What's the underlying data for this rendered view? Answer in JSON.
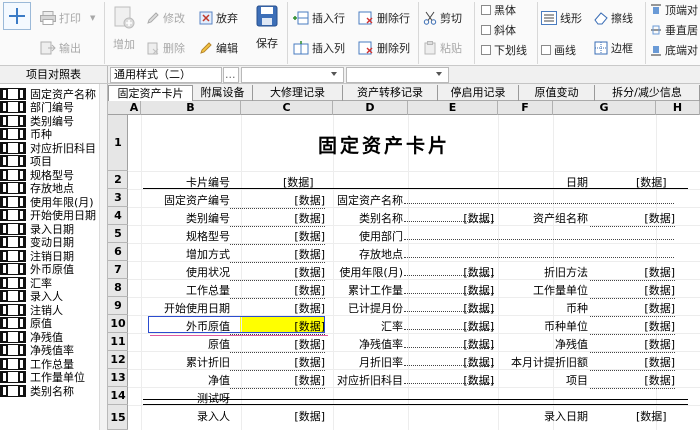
{
  "toolbar": {
    "print": "打印",
    "output": "输出",
    "add": "增加",
    "modify": "修改",
    "delete": "删除",
    "discard": "放弃",
    "edit": "编辑",
    "save": "保存",
    "insert_row": "插入行",
    "insert_col": "插入列",
    "delete_row": "删除行",
    "delete_col": "删除列",
    "cut": "剪切",
    "paste": "粘贴",
    "bold": "黑体",
    "italic": "斜体",
    "underline": "下划线",
    "line_shape": "线形",
    "draw_line": "画线",
    "erase_line": "擦线",
    "border": "边框",
    "align_top": "顶端对",
    "align_middle": "垂直居",
    "align_bottom": "底端对"
  },
  "format_row": {
    "panel_title": "项目对照表",
    "style_value": "通用样式（二）",
    "ellipsis": "..."
  },
  "left_panel": {
    "items": [
      "固定资产名称",
      "部门编号",
      "类别编号",
      "币种",
      "对应折旧科目",
      "项目",
      "规格型号",
      "存放地点",
      "使用年限(月)",
      "开始使用日期",
      "录入日期",
      "变动日期",
      "注销日期",
      "外币原值",
      "汇率",
      "录入人",
      "注销人",
      "原值",
      "净残值",
      "净残值率",
      "工作总量",
      "工作量单位",
      "类别名称"
    ]
  },
  "tabs": [
    "固定资产卡片",
    "附属设备",
    "大修理记录",
    "资产转移记录",
    "停启用记录",
    "原值变动",
    "拆分/减少信息"
  ],
  "sheet": {
    "columns": [
      "A",
      "B",
      "C",
      "D",
      "E",
      "F",
      "G",
      "H"
    ],
    "rows": [
      "1",
      "2",
      "3",
      "4",
      "5",
      "6",
      "7",
      "8",
      "9",
      "10",
      "11",
      "12",
      "13",
      "14",
      "15"
    ],
    "title": "固定资产卡片",
    "placeholder": "[数据]",
    "r2": {
      "card_no": "卡片编号",
      "date": "日期"
    },
    "r3": {
      "b": "固定资产编号",
      "d": "固定资产名称"
    },
    "r4": {
      "b": "类别编号",
      "d": "类别名称",
      "f": "资产组名称"
    },
    "r5": {
      "b": "规格型号",
      "d": "使用部门"
    },
    "r6": {
      "b": "增加方式",
      "d": "存放地点"
    },
    "r7": {
      "b": "使用状况",
      "d": "使用年限(月)",
      "f": "折旧方法"
    },
    "r8": {
      "b": "工作总量",
      "d": "累计工作量",
      "f": "工作量单位"
    },
    "r9": {
      "b": "开始使用日期",
      "d": "已计提月份",
      "f": "币种"
    },
    "r10": {
      "b": "外币原值",
      "d": "汇率",
      "f": "币种单位"
    },
    "r11": {
      "b": "原值",
      "d": "净残值率",
      "f": "净残值"
    },
    "r12": {
      "b": "累计折旧",
      "d": "月折旧率",
      "f": "本月计提折旧额"
    },
    "r13": {
      "b": "净值",
      "d": "对应折旧科目",
      "f": "项目"
    },
    "r14": {
      "b": "测试呀"
    },
    "r15": {
      "b": "录入人",
      "f": "录入日期"
    }
  }
}
